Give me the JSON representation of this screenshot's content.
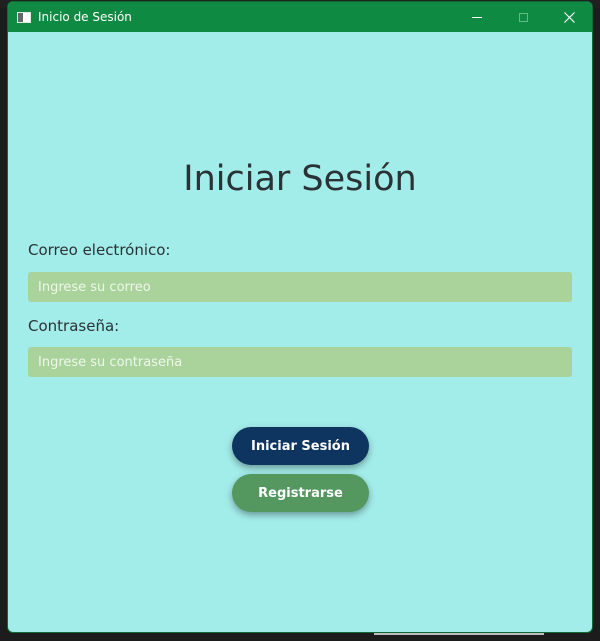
{
  "window": {
    "title": "Inicio de Sesión",
    "controls": {
      "minimize": "minimize-icon",
      "maximize": "maximize-icon",
      "close": "close-icon"
    }
  },
  "form": {
    "heading": "Iniciar Sesión",
    "email_label": "Correo electrónico:",
    "email_placeholder": "Ingrese su correo",
    "email_value": "",
    "password_label": "Contraseña:",
    "password_placeholder": "Ingrese su contraseña",
    "password_value": "",
    "login_button": "Iniciar Sesión",
    "register_button": "Registrarse"
  },
  "colors": {
    "titlebar": "#0f8a42",
    "background": "#a2ece9",
    "input": "#a9d39b",
    "login_button": "#0e3460",
    "register_button": "#54985f"
  }
}
